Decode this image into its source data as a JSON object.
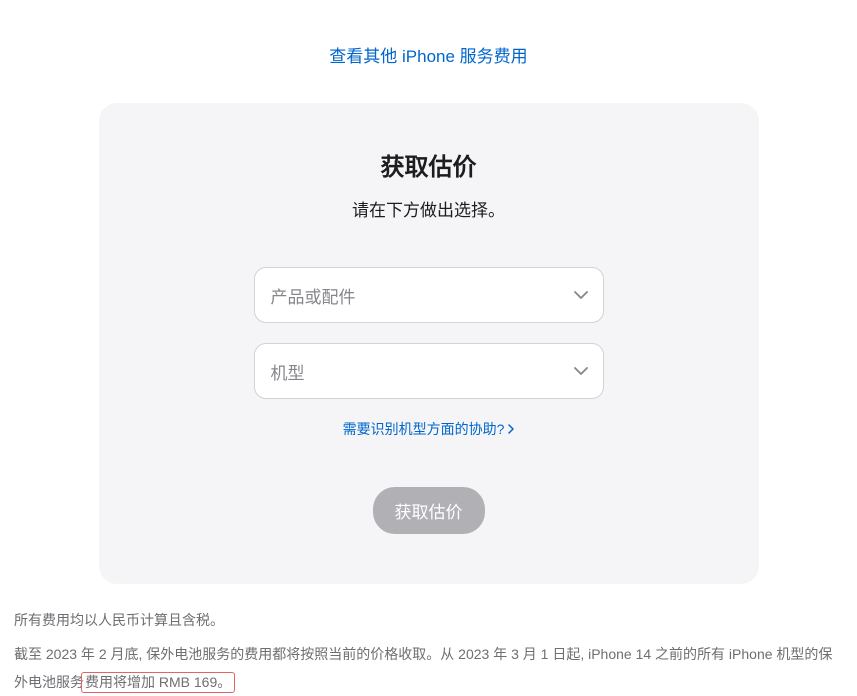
{
  "topLink": {
    "label": "查看其他 iPhone 服务费用"
  },
  "card": {
    "title": "获取估价",
    "subtitle": "请在下方做出选择。",
    "selectProductPlaceholder": "产品或配件",
    "selectModelPlaceholder": "机型",
    "helpLinkLabel": "需要识别机型方面的协助?",
    "submitLabel": "获取估价"
  },
  "footnotes": {
    "line1": "所有费用均以人民币计算且含税。",
    "line2_a": "截至 2023 年 2 月底, 保外电池服务的费用都将按照当前的价格收取。从 2023 年 3 月 1 日起, iPhone 14 之前的所有 iPhone 机型的保外电池服务",
    "line2_b": "费用将增加 RMB 169。"
  }
}
